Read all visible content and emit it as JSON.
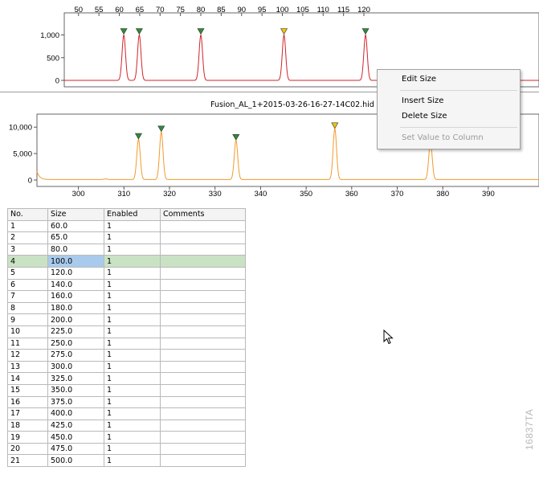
{
  "top_panel": {
    "x_ticks": [
      "50",
      "55",
      "60",
      "65",
      "70",
      "75",
      "80",
      "85",
      "90",
      "95",
      "100",
      "105",
      "110",
      "115",
      "120"
    ],
    "y_ticks": [
      "1,000",
      "500",
      "0"
    ],
    "line_color": "#d0242b",
    "peaks": [
      {
        "x": 61.1,
        "y": 1000,
        "marker": "ok"
      },
      {
        "x": 64.9,
        "y": 1000,
        "marker": "ok"
      },
      {
        "x": 80.0,
        "y": 1000,
        "marker": "ok"
      },
      {
        "x": 100.4,
        "y": 1000,
        "marker": "selected"
      },
      {
        "x": 120.4,
        "y": 1000,
        "marker": "ok"
      }
    ]
  },
  "bottom_panel": {
    "title": "Fusion_AL_1+2015-03-26-16-27-14C02.hid",
    "x_ticks": [
      "300",
      "310",
      "320",
      "330",
      "340",
      "350",
      "360",
      "370",
      "380",
      "390"
    ],
    "y_ticks": [
      "10,000",
      "5,000",
      "0"
    ],
    "line_color": "#f39a2b",
    "peaks": [
      {
        "x": 313.2,
        "y": 7600,
        "marker": "ok"
      },
      {
        "x": 318.2,
        "y": 9000,
        "marker": "ok"
      },
      {
        "x": 334.6,
        "y": 7400,
        "marker": "ok"
      },
      {
        "x": 356.3,
        "y": 9600,
        "marker": "selected"
      },
      {
        "x": 377.3,
        "y": 7000,
        "marker": "none"
      }
    ]
  },
  "colors": {
    "marker_ok": "#2e8b3a",
    "marker_selected": "#f2c400",
    "row_selected": "#c9e2c4",
    "cell_selected": "#a8cbed"
  },
  "context_menu": {
    "edit_size": "Edit Size",
    "insert_size": "Insert Size",
    "delete_size": "Delete Size",
    "set_value": "Set Value to Column"
  },
  "table": {
    "headers": {
      "no": "No.",
      "size": "Size",
      "enabled": "Enabled",
      "comments": "Comments"
    },
    "rows": [
      {
        "no": "1",
        "size": "60.0",
        "enabled": "1",
        "comments": ""
      },
      {
        "no": "2",
        "size": "65.0",
        "enabled": "1",
        "comments": ""
      },
      {
        "no": "3",
        "size": "80.0",
        "enabled": "1",
        "comments": ""
      },
      {
        "no": "4",
        "size": "100.0",
        "enabled": "1",
        "comments": ""
      },
      {
        "no": "5",
        "size": "120.0",
        "enabled": "1",
        "comments": ""
      },
      {
        "no": "6",
        "size": "140.0",
        "enabled": "1",
        "comments": ""
      },
      {
        "no": "7",
        "size": "160.0",
        "enabled": "1",
        "comments": ""
      },
      {
        "no": "8",
        "size": "180.0",
        "enabled": "1",
        "comments": ""
      },
      {
        "no": "9",
        "size": "200.0",
        "enabled": "1",
        "comments": ""
      },
      {
        "no": "10",
        "size": "225.0",
        "enabled": "1",
        "comments": ""
      },
      {
        "no": "11",
        "size": "250.0",
        "enabled": "1",
        "comments": ""
      },
      {
        "no": "12",
        "size": "275.0",
        "enabled": "1",
        "comments": ""
      },
      {
        "no": "13",
        "size": "300.0",
        "enabled": "1",
        "comments": ""
      },
      {
        "no": "14",
        "size": "325.0",
        "enabled": "1",
        "comments": ""
      },
      {
        "no": "15",
        "size": "350.0",
        "enabled": "1",
        "comments": ""
      },
      {
        "no": "16",
        "size": "375.0",
        "enabled": "1",
        "comments": ""
      },
      {
        "no": "17",
        "size": "400.0",
        "enabled": "1",
        "comments": ""
      },
      {
        "no": "18",
        "size": "425.0",
        "enabled": "1",
        "comments": ""
      },
      {
        "no": "19",
        "size": "450.0",
        "enabled": "1",
        "comments": ""
      },
      {
        "no": "20",
        "size": "475.0",
        "enabled": "1",
        "comments": ""
      },
      {
        "no": "21",
        "size": "500.0",
        "enabled": "1",
        "comments": ""
      }
    ]
  },
  "figure_id": "16837TA"
}
